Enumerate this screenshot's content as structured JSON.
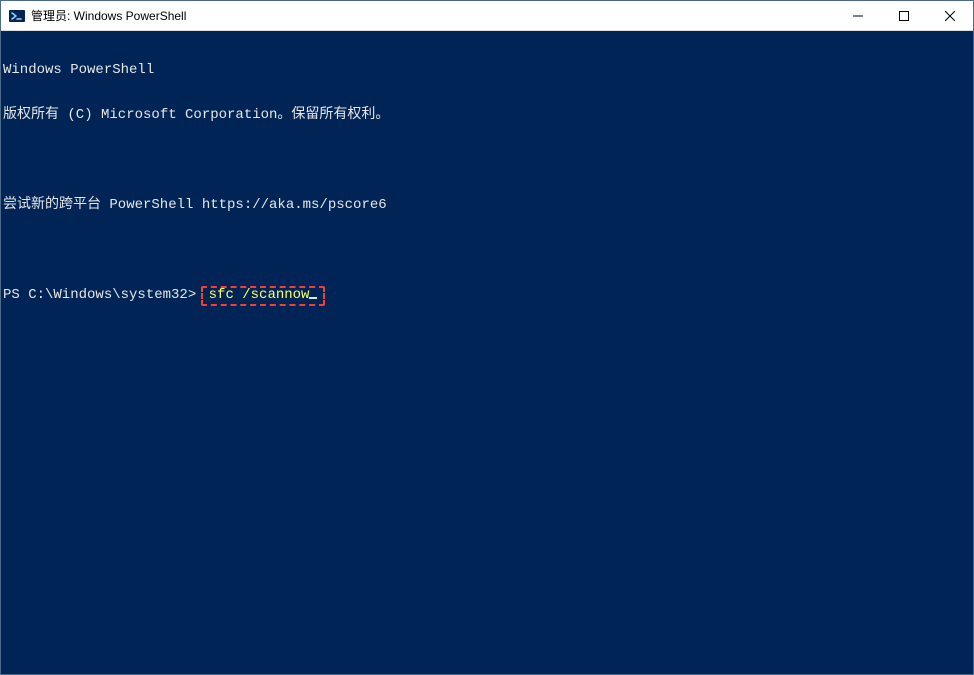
{
  "window": {
    "title": "管理员: Windows PowerShell"
  },
  "terminal": {
    "line1": "Windows PowerShell",
    "line2": "版权所有 (C) Microsoft Corporation。保留所有权利。",
    "line3": "",
    "line4": "尝试新的跨平台 PowerShell https://aka.ms/pscore6",
    "line5": "",
    "prompt_prefix": "PS C:\\Windows\\system32> ",
    "command": "sfc /scannow"
  }
}
